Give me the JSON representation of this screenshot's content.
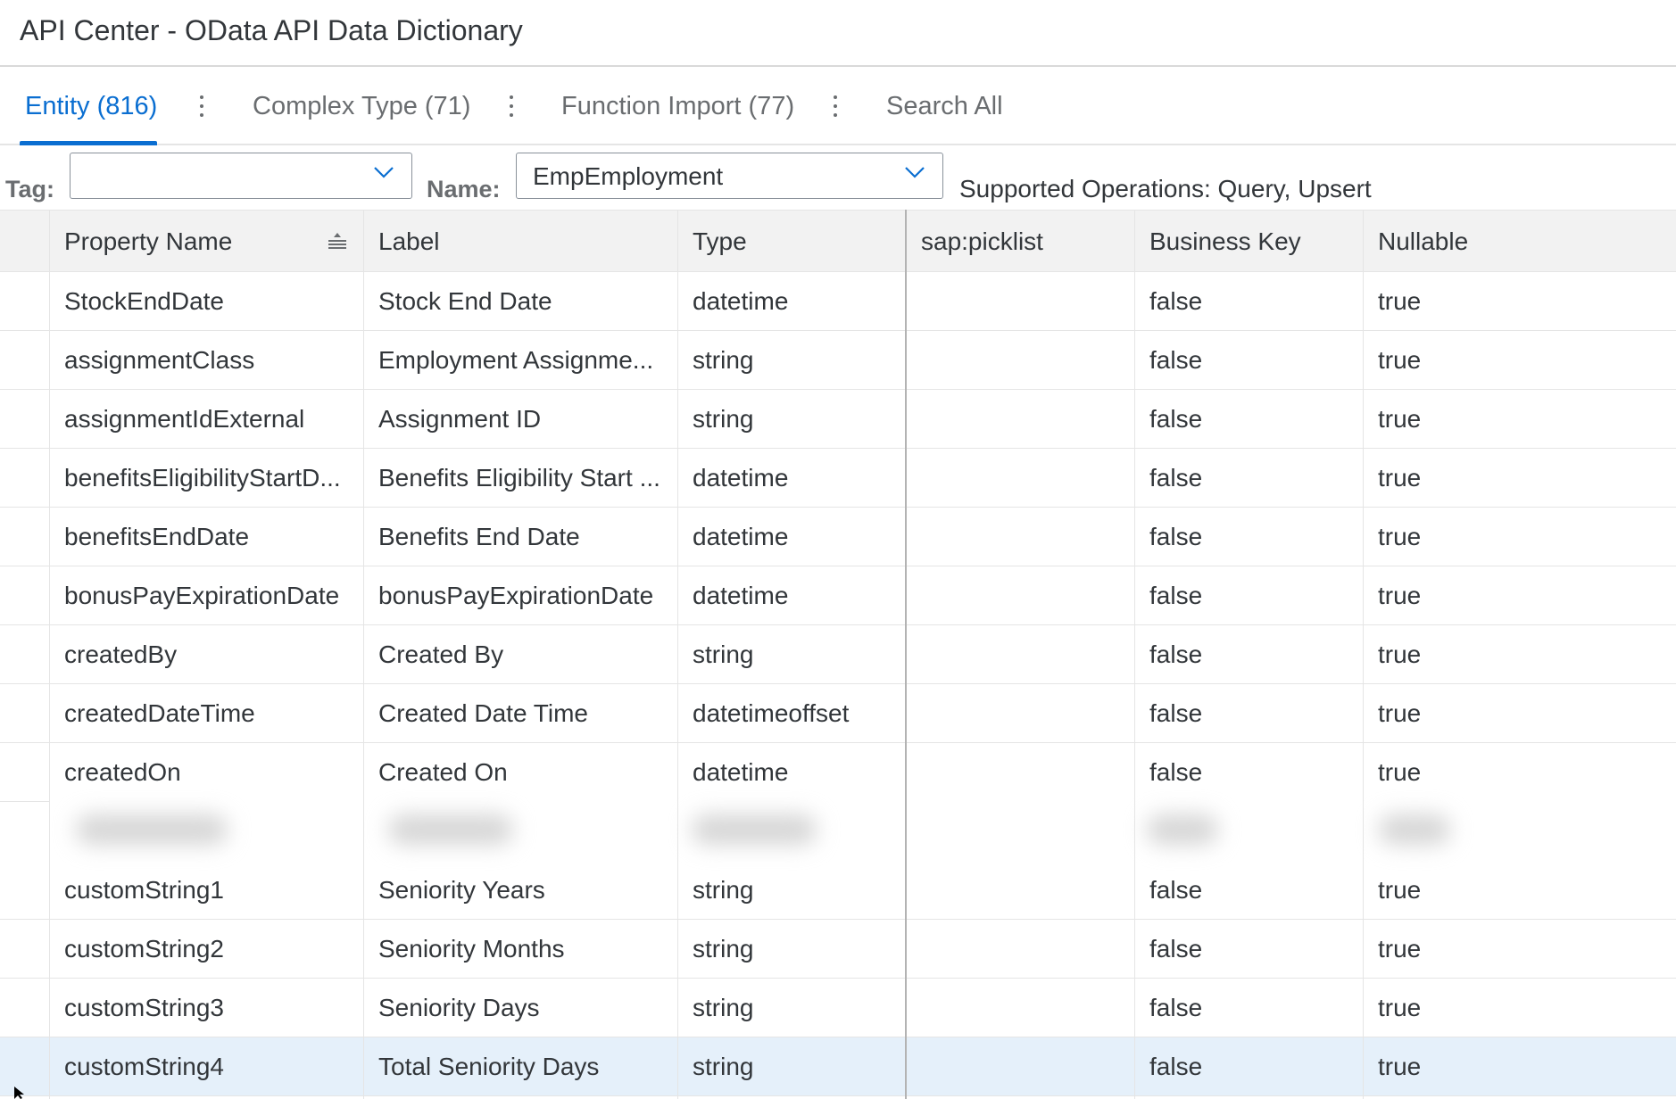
{
  "header": {
    "title": "API Center - OData API Data Dictionary"
  },
  "tabs": [
    {
      "label": "Entity (816)",
      "active": true
    },
    {
      "label": "Complex Type (71)",
      "active": false
    },
    {
      "label": "Function Import (77)",
      "active": false
    },
    {
      "label": "Search All",
      "active": false
    }
  ],
  "filters": {
    "tag_label": "Tag:",
    "tag_value": "",
    "name_label": "Name:",
    "name_value": "EmpEmployment",
    "supported_operations": "Supported Operations: Query, Upsert"
  },
  "table": {
    "columns": [
      "Property Name",
      "Label",
      "Type",
      "sap:picklist",
      "Business Key",
      "Nullable"
    ],
    "sorted_column": "Property Name",
    "rows": [
      {
        "property": "StockEndDate",
        "label": "Stock End Date",
        "type": "datetime",
        "picklist": "",
        "business_key": "false",
        "nullable": "true"
      },
      {
        "property": "assignmentClass",
        "label": "Employment Assignme...",
        "type": "string",
        "picklist": "",
        "business_key": "false",
        "nullable": "true"
      },
      {
        "property": "assignmentIdExternal",
        "label": "Assignment ID",
        "type": "string",
        "picklist": "",
        "business_key": "false",
        "nullable": "true"
      },
      {
        "property": "benefitsEligibilityStartD...",
        "label": "Benefits Eligibility Start ...",
        "type": "datetime",
        "picklist": "",
        "business_key": "false",
        "nullable": "true"
      },
      {
        "property": "benefitsEndDate",
        "label": "Benefits End Date",
        "type": "datetime",
        "picklist": "",
        "business_key": "false",
        "nullable": "true"
      },
      {
        "property": "bonusPayExpirationDate",
        "label": "bonusPayExpirationDate",
        "type": "datetime",
        "picklist": "",
        "business_key": "false",
        "nullable": "true"
      },
      {
        "property": "createdBy",
        "label": "Created By",
        "type": "string",
        "picklist": "",
        "business_key": "false",
        "nullable": "true"
      },
      {
        "property": "createdDateTime",
        "label": "Created Date Time",
        "type": "datetimeoffset",
        "picklist": "",
        "business_key": "false",
        "nullable": "true"
      },
      {
        "property": "createdOn",
        "label": "Created On",
        "type": "datetime",
        "picklist": "",
        "business_key": "false",
        "nullable": "true"
      },
      {
        "property": "customString1",
        "label": "Seniority Years",
        "type": "string",
        "picklist": "",
        "business_key": "false",
        "nullable": "true"
      },
      {
        "property": "customString2",
        "label": "Seniority Months",
        "type": "string",
        "picklist": "",
        "business_key": "false",
        "nullable": "true"
      },
      {
        "property": "customString3",
        "label": "Seniority Days",
        "type": "string",
        "picklist": "",
        "business_key": "false",
        "nullable": "true"
      },
      {
        "property": "customString4",
        "label": "Total Seniority Days",
        "type": "string",
        "picklist": "",
        "business_key": "false",
        "nullable": "true"
      }
    ],
    "selected_row": "customString4",
    "blurred_row_present": true
  },
  "icons": {
    "tab_menu": "vertical-ellipsis-icon",
    "dropdown": "chevron-down-icon",
    "sort": "sort-ascending-icon",
    "cursor": "mouse-pointer-icon"
  },
  "colors": {
    "accent": "#0a6ed1",
    "text": "#32363a",
    "muted_text": "#6a6d70",
    "header_bg": "#f2f2f2",
    "selected_row_bg": "#e5f0fa",
    "border": "#e5e5e5"
  }
}
